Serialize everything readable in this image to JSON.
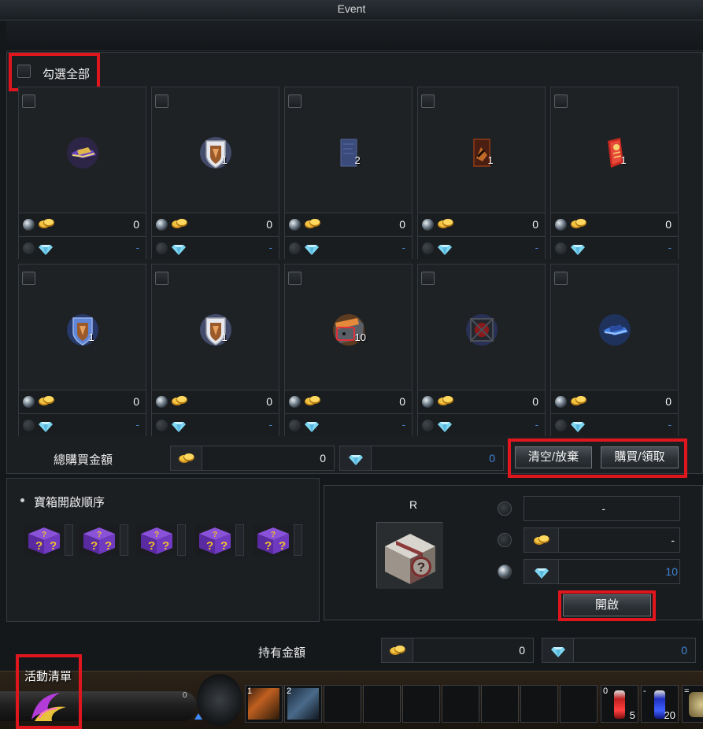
{
  "window": {
    "title": "Event"
  },
  "select_all_label": "勾選全部",
  "items": [
    {
      "icon": "winged-helmet-icon",
      "qty": "",
      "gold": "0",
      "diamond": "-"
    },
    {
      "icon": "fox-shield-icon",
      "qty": "1",
      "gold": "0",
      "diamond": "-"
    },
    {
      "icon": "blue-scroll-icon",
      "qty": "2",
      "gold": "0",
      "diamond": "-"
    },
    {
      "icon": "brown-card-icon",
      "qty": "1",
      "gold": "0",
      "diamond": "-"
    },
    {
      "icon": "red-talisman-icon",
      "qty": "1",
      "gold": "0",
      "diamond": "-"
    },
    {
      "icon": "blue-shield-icon",
      "qty": "1",
      "gold": "0",
      "diamond": "-"
    },
    {
      "icon": "fox-shield-icon",
      "qty": "1",
      "gold": "0",
      "diamond": "-"
    },
    {
      "icon": "orange-chest-icon",
      "qty": "10",
      "gold": "0",
      "diamond": "-"
    },
    {
      "icon": "dark-seal-icon",
      "qty": "",
      "gold": "0",
      "diamond": "-"
    },
    {
      "icon": "blue-winged-helmet-icon",
      "qty": "",
      "gold": "0",
      "diamond": "-"
    }
  ],
  "total": {
    "label": "總購買金額",
    "gold": "0",
    "diamond": "0"
  },
  "buttons": {
    "clear": "清空/放棄",
    "buy": "購買/領取",
    "open": "開啟"
  },
  "order": {
    "title": "寶箱開啟順序",
    "boxes": [
      "mystery-box-icon",
      "mystery-box-icon",
      "mystery-box-icon",
      "mystery-box-icon",
      "mystery-box-icon"
    ]
  },
  "open_panel": {
    "grade": "R",
    "box_icon": "silver-mystery-chest-icon",
    "options": [
      {
        "selected": false,
        "currency": "",
        "value": "-"
      },
      {
        "selected": false,
        "currency": "gold",
        "value": "-"
      },
      {
        "selected": true,
        "currency": "diamond",
        "value": "10"
      }
    ]
  },
  "holding": {
    "label": "持有金額",
    "gold": "0",
    "diamond": "0"
  },
  "hotbar": {
    "activity_label": "活動清單",
    "slots": [
      {
        "num": "1",
        "count": ""
      },
      {
        "num": "2",
        "count": ""
      },
      {
        "num": "0",
        "count": "5"
      },
      {
        "num": "-",
        "count": "20"
      },
      {
        "num": "=",
        "count": ""
      }
    ]
  },
  "colors": {
    "highlight": "#e0161e",
    "blue_value": "#3f86d8"
  }
}
